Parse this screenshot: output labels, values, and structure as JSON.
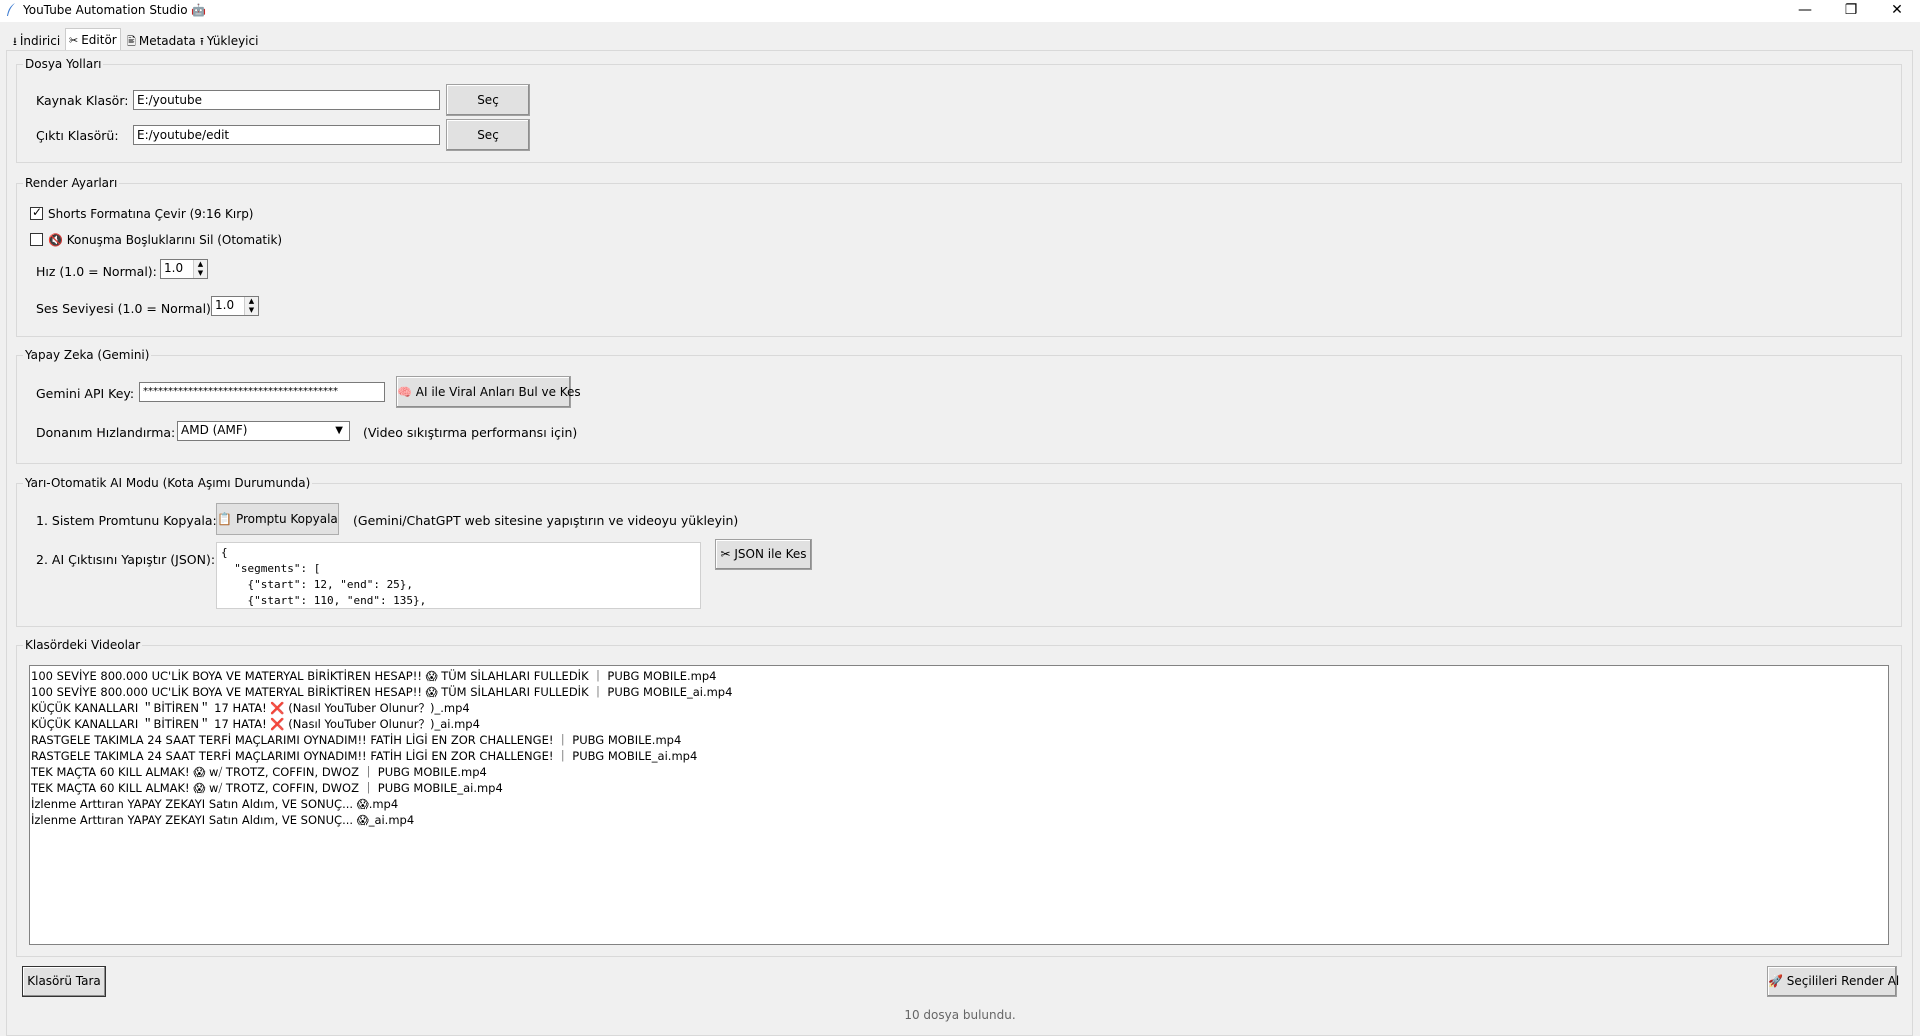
{
  "window": {
    "title": "YouTube Automation Studio 🤖",
    "controls": {
      "minimize": "—",
      "maximize": "❐",
      "close": "✕"
    }
  },
  "tabs": [
    {
      "icon": "⭳",
      "label": "İndirici"
    },
    {
      "icon": "✂",
      "label": "Editör"
    },
    {
      "icon": "🖹",
      "label": "Metadata"
    },
    {
      "icon": "⭱",
      "label": "Yükleyici"
    }
  ],
  "paths": {
    "group_title": "Dosya Yolları",
    "source_label": "Kaynak Klasör:",
    "source_value": "E:/youtube",
    "output_label": "Çıktı Klasörü:",
    "output_value": "E:/youtube/edit",
    "browse_label": "Seç"
  },
  "render": {
    "group_title": "Render Ayarları",
    "shorts_label": "Shorts Formatına Çevir (9:16 Kırp)",
    "shorts_checked": true,
    "silence_label": "🔇 Konuşma Boşluklarını Sil (Otomatik)",
    "silence_checked": false,
    "speed_label": "Hız (1.0 = Normal):",
    "speed_value": "1.0",
    "volume_label": "Ses Seviyesi (1.0 = Normal):",
    "volume_value": "1.0"
  },
  "ai": {
    "group_title": "Yapay Zeka (Gemini)",
    "api_key_label": "Gemini API Key:",
    "api_key_value": "***************************************",
    "viral_button": "🧠 AI ile Viral Anları Bul ve Kes",
    "hw_label": "Donanım Hızlandırma:",
    "hw_value": "AMD (AMF)",
    "hw_note": "(Video sıkıştırma performansı için)"
  },
  "semi": {
    "group_title": "Yarı-Otomatik AI Modu (Kota Aşımı Durumunda)",
    "step1_label": "1. Sistem Promtunu Kopyala:",
    "copy_button": "📋 Promptu Kopyala",
    "step1_note": "(Gemini/ChatGPT web sitesine yapıştırın ve videoyu yükleyin)",
    "step2_label": "2. AI Çıktısını Yapıştır (JSON):",
    "json_text": "{\n  \"segments\": [\n    {\"start\": 12, \"end\": 25},\n    {\"start\": 110, \"end\": 135},",
    "json_button": "✂ JSON ile Kes"
  },
  "videos": {
    "group_title": "Klasördeki Videolar",
    "items": [
      "100 SEVİYE 800.000 UC'LİK BOYA VE MATERYAL BİRİKTİREN HESAP!! 😱 TÜM SİLAHLARI FULLEDİK ｜ PUBG MOBILE.mp4",
      "100 SEVİYE 800.000 UC'LİK BOYA VE MATERYAL BİRİKTİREN HESAP!! 😱 TÜM SİLAHLARI FULLEDİK ｜ PUBG MOBILE_ai.mp4",
      "KÜÇÜK KANALLARI ＂BİTİREN＂ 17 HATA! ❌ (Nasıl YouTuber Olunur？)_.mp4",
      "KÜÇÜK KANALLARI ＂BİTİREN＂ 17 HATA! ❌ (Nasıl YouTuber Olunur？)_ai.mp4",
      "RASTGELE TAKIMLA 24 SAAT TERFİ MAÇLARIMI OYNADIM!! FATİH LİGİ EN ZOR CHALLENGE! ｜ PUBG MOBILE.mp4",
      "RASTGELE TAKIMLA 24 SAAT TERFİ MAÇLARIMI OYNADIM!! FATİH LİGİ EN ZOR CHALLENGE! ｜ PUBG MOBILE_ai.mp4",
      "TEK MAÇTA 60 KILL ALMAK! 😱 w⧸ TROTZ, COFFIN, DWOZ ｜ PUBG MOBILE.mp4",
      "TEK MAÇTA 60 KILL ALMAK! 😱 w⧸ TROTZ, COFFIN, DWOZ ｜ PUBG MOBILE_ai.mp4",
      "İzlenme Arttıran YAPAY ZEKAYI Satın Aldım, VE SONUÇ... 😱.mp4",
      "İzlenme Arttıran YAPAY ZEKAYI Satın Aldım, VE SONUÇ... 😱_ai.mp4"
    ],
    "scan_button": "Klasörü Tara",
    "render_button": "🚀 Seçilileri Render Al"
  },
  "status": "10 dosya bulundu."
}
